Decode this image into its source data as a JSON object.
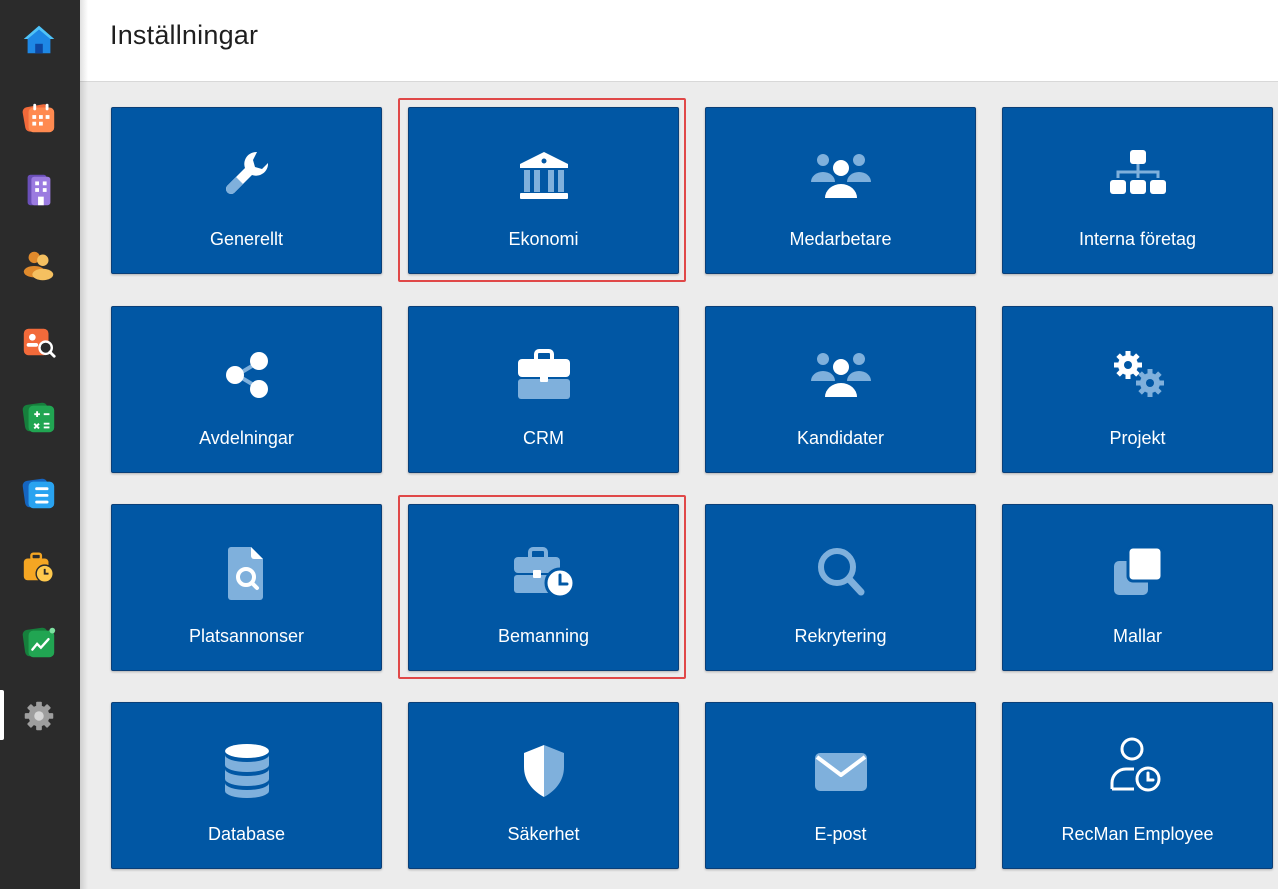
{
  "page": {
    "title": "Inställningar"
  },
  "sidebar": {
    "items": [
      {
        "icon": "home-icon",
        "color": "#1e88e5"
      },
      {
        "icon": "calendar-icon",
        "color": "#f26a3a"
      },
      {
        "icon": "building-icon",
        "color": "#7b5fc4"
      },
      {
        "icon": "users-icon",
        "color": "#f0a93a"
      },
      {
        "icon": "candidate-search-icon",
        "color": "#f26a3a"
      },
      {
        "icon": "calculator-icon",
        "color": "#21a552"
      },
      {
        "icon": "list-icon",
        "color": "#1e88e5"
      },
      {
        "icon": "briefcase-clock-icon",
        "color": "#f5a623"
      },
      {
        "icon": "chart-icon",
        "color": "#21a552"
      },
      {
        "icon": "settings-icon",
        "color": "#bdbdbd",
        "active": true
      }
    ]
  },
  "tiles": [
    {
      "label": "Generellt",
      "icon": "wrench-icon",
      "highlighted": false
    },
    {
      "label": "Ekonomi",
      "icon": "bank-icon",
      "highlighted": true
    },
    {
      "label": "Medarbetare",
      "icon": "group-icon",
      "highlighted": false
    },
    {
      "label": "Interna företag",
      "icon": "sitemap-icon",
      "highlighted": false
    },
    {
      "label": "Avdelningar",
      "icon": "share-icon",
      "highlighted": false
    },
    {
      "label": "CRM",
      "icon": "briefcase-icon",
      "highlighted": false
    },
    {
      "label": "Kandidater",
      "icon": "group-icon",
      "highlighted": false
    },
    {
      "label": "Projekt",
      "icon": "gears-icon",
      "highlighted": false
    },
    {
      "label": "Platsannonser",
      "icon": "file-search-icon",
      "highlighted": false
    },
    {
      "label": "Bemanning",
      "icon": "briefcase-clock-icon",
      "highlighted": true
    },
    {
      "label": "Rekrytering",
      "icon": "magnifier-icon",
      "highlighted": false
    },
    {
      "label": "Mallar",
      "icon": "clone-icon",
      "highlighted": false
    },
    {
      "label": "Database",
      "icon": "database-icon",
      "highlighted": false
    },
    {
      "label": "Säkerhet",
      "icon": "shield-icon",
      "highlighted": false
    },
    {
      "label": "E-post",
      "icon": "envelope-icon",
      "highlighted": false
    },
    {
      "label": "RecMan Employee",
      "icon": "user-clock-icon",
      "highlighted": false
    }
  ],
  "colors": {
    "tile": "#0157a4",
    "icon_light": "#ffffff",
    "icon_muted": "#7fb0dc",
    "highlight": "#e04848",
    "sidebar": "#2b2b2b"
  }
}
